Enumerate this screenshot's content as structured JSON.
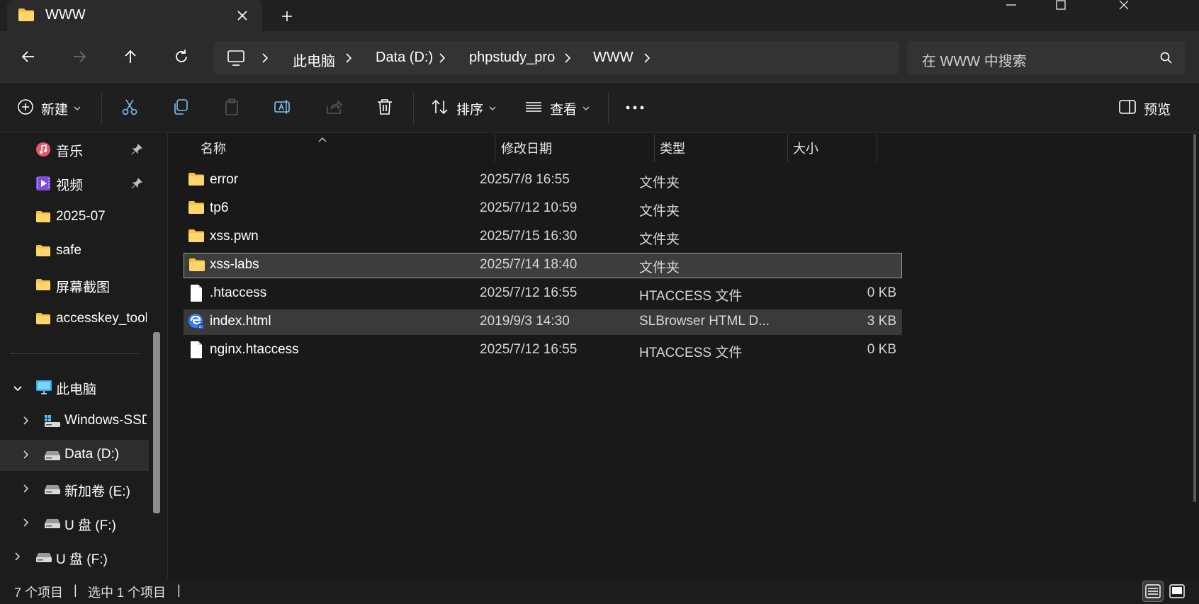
{
  "window": {
    "tab_title": "WWW",
    "new_tab_symbol": "+"
  },
  "address": {
    "breadcrumbs": [
      "此电脑",
      "Data (D:)",
      "phpstudy_pro",
      "WWW"
    ],
    "search_placeholder": "在 WWW 中搜索"
  },
  "toolbar": {
    "new_label": "新建",
    "sort_label": "排序",
    "view_label": "查看",
    "preview_label": "预览",
    "more_icon": "more-icon"
  },
  "sidebar": {
    "items": [
      {
        "label": "音乐",
        "icon": "music-icon",
        "pinned": true
      },
      {
        "label": "视频",
        "icon": "video-icon",
        "pinned": true
      },
      {
        "label": "2025-07",
        "icon": "folder-icon",
        "pinned": false
      },
      {
        "label": "safe",
        "icon": "folder-icon",
        "pinned": false
      },
      {
        "label": "屏幕截图",
        "icon": "folder-icon",
        "pinned": false
      },
      {
        "label": "accesskey_tools",
        "icon": "folder-icon",
        "pinned": false
      }
    ],
    "this_pc": {
      "label": "此电脑",
      "expanded": true
    },
    "drives": [
      {
        "label": "Windows-SSD",
        "icon": "windows-drive-icon",
        "active": false
      },
      {
        "label": "Data (D:)",
        "icon": "drive-icon",
        "active": true
      },
      {
        "label": "新加卷 (E:)",
        "icon": "drive-icon",
        "active": false
      },
      {
        "label": "U 盘 (F:)",
        "icon": "drive-icon",
        "active": false
      }
    ],
    "extra_drive": {
      "label": "U 盘 (F:)",
      "icon": "drive-icon"
    }
  },
  "columns": {
    "name": "名称",
    "modified": "修改日期",
    "type": "类型",
    "size": "大小"
  },
  "files": [
    {
      "name": "error",
      "modified": "2025/7/8 16:55",
      "type": "文件夹",
      "size": "",
      "icon": "folder-icon",
      "state": "normal"
    },
    {
      "name": "tp6",
      "modified": "2025/7/12 10:59",
      "type": "文件夹",
      "size": "",
      "icon": "folder-icon",
      "state": "normal"
    },
    {
      "name": "xss.pwn",
      "modified": "2025/7/15 16:30",
      "type": "文件夹",
      "size": "",
      "icon": "folder-icon",
      "state": "normal"
    },
    {
      "name": "xss-labs",
      "modified": "2025/7/14 18:40",
      "type": "文件夹",
      "size": "",
      "icon": "folder-icon",
      "state": "selected"
    },
    {
      "name": ".htaccess",
      "modified": "2025/7/12 16:55",
      "type": "HTACCESS 文件",
      "size": "0 KB",
      "icon": "file-icon",
      "state": "normal"
    },
    {
      "name": "index.html",
      "modified": "2019/9/3 14:30",
      "type": "SLBrowser HTML D...",
      "size": "3 KB",
      "icon": "browser-html-icon",
      "state": "hover"
    },
    {
      "name": "nginx.htaccess",
      "modified": "2025/7/12 16:55",
      "type": "HTACCESS 文件",
      "size": "0 KB",
      "icon": "file-icon",
      "state": "normal"
    }
  ],
  "status": {
    "item_count": "7 个项目",
    "selected_count": "选中 1 个项目",
    "separator": "|"
  },
  "colors": {
    "folder": "#f6c342",
    "accent": "#4cc2ff",
    "background": "#191919"
  }
}
